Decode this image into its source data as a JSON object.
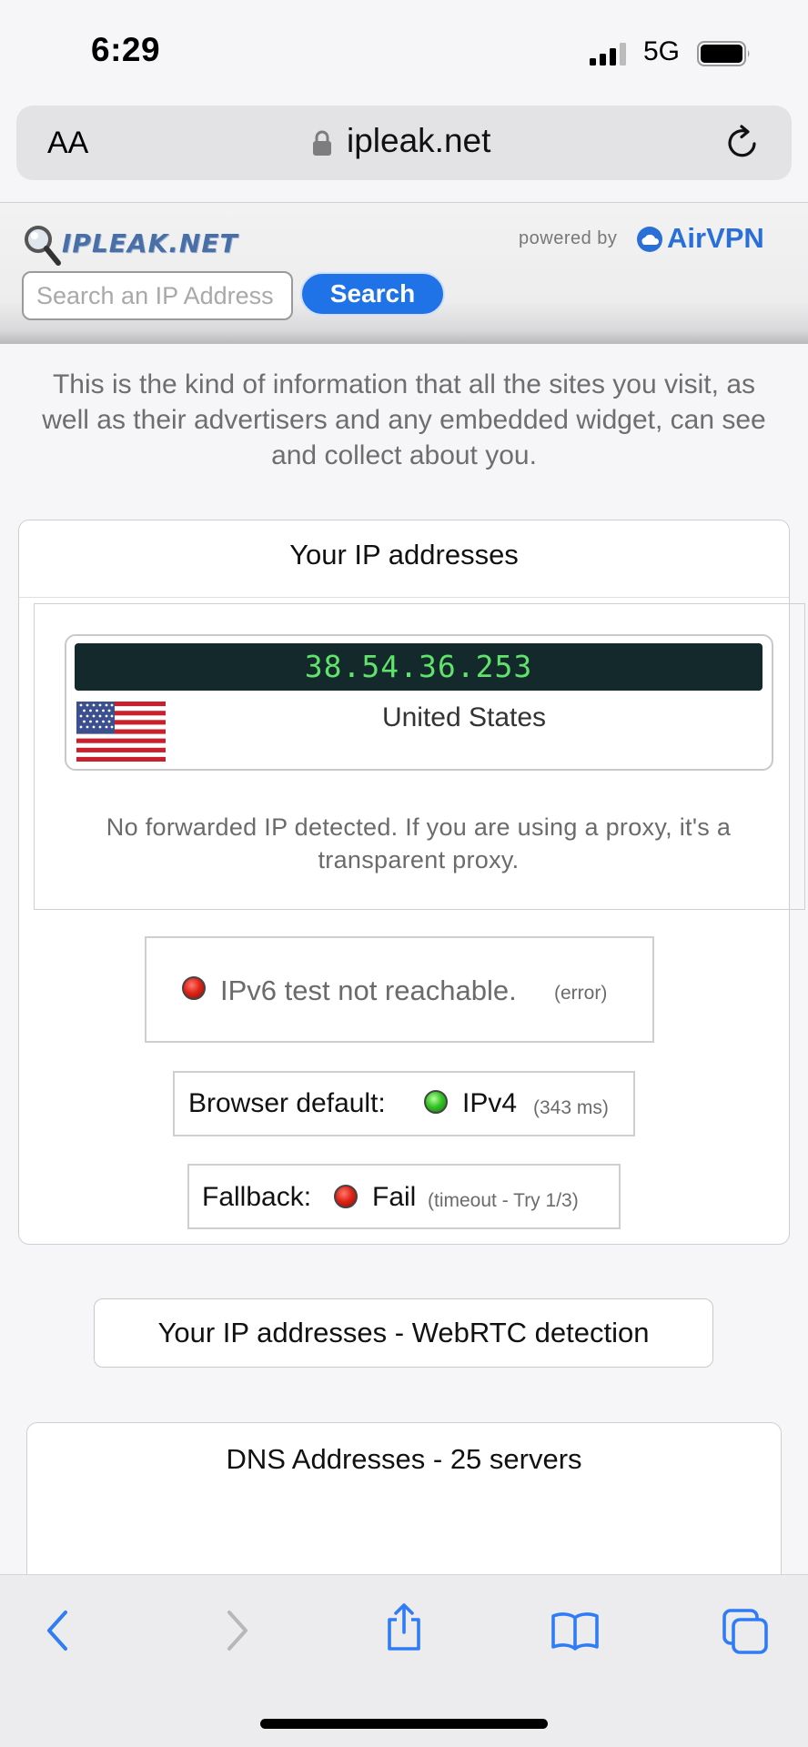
{
  "status_bar": {
    "time": "6:29",
    "network": "5G"
  },
  "url_bar": {
    "text_size_label": "AA",
    "url": "ipleak.net"
  },
  "site_header": {
    "logo_text": "IPLEAK.NET",
    "powered_by": "powered by",
    "brand": "AirVPN",
    "search_placeholder": "Search an IP Address",
    "search_button": "Search"
  },
  "intro": "This is the kind of information that all the sites you visit, as well as their advertisers and any embedded widget, can see and collect about you.",
  "ip_card": {
    "title": "Your IP addresses",
    "ip": "38.54.36.253",
    "country": "United States",
    "forwarded_note": "No forwarded IP detected. If you are using a proxy, it's a transparent proxy.",
    "ipv6_text": "IPv6 test not reachable.",
    "ipv6_note": "(error)",
    "browser_label": "Browser default:",
    "browser_value": "IPv4",
    "browser_ms": "(343 ms)",
    "fallback_label": "Fallback:",
    "fallback_value": "Fail",
    "fallback_note": "(timeout - Try 1/3)"
  },
  "webrtc_button": "Your IP addresses - WebRTC detection",
  "dns_card": {
    "title": "DNS Addresses - 25 servers"
  },
  "colors": {
    "accent": "#1f73e6",
    "ip_bg": "#13292c",
    "ip_text": "#5fe36a",
    "status_red": "#e02518",
    "status_green": "#36c428",
    "ios_blue": "#2f7cf6"
  },
  "toolbar": {
    "icons": [
      "chevron-back-icon",
      "chevron-forward-icon",
      "share-icon",
      "bookmarks-icon",
      "tabs-icon"
    ]
  }
}
